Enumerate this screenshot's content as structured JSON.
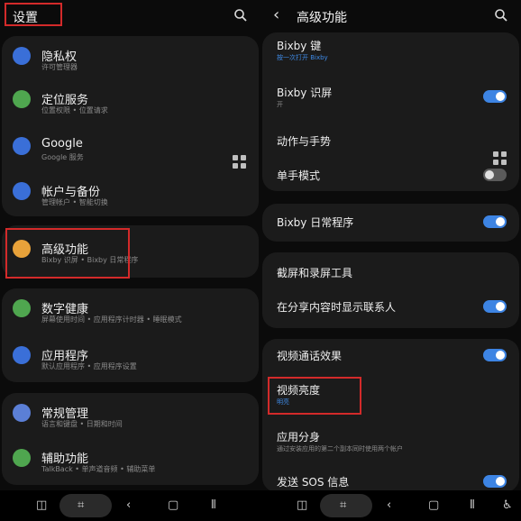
{
  "left": {
    "title": "设置",
    "items": [
      {
        "title": "隐私权",
        "subtitle": "许可管理器"
      },
      {
        "title": "定位服务",
        "subtitle": "位置权限 • 位置请求"
      },
      {
        "title": "Google",
        "subtitle": "Google 服务"
      },
      {
        "title": "帐户与备份",
        "subtitle": "管理帐户 • 智能切换"
      },
      {
        "title": "高级功能",
        "subtitle": "Bixby 识屏 • Bixby 日常程序"
      },
      {
        "title": "数字健康",
        "subtitle": "屏幕使用时间 • 应用程序计时器 • 睡眠模式"
      },
      {
        "title": "应用程序",
        "subtitle": "默认应用程序 • 应用程序设置"
      },
      {
        "title": "常规管理",
        "subtitle": "语言和键盘 • 日期和时间"
      },
      {
        "title": "辅助功能",
        "subtitle": "TalkBack • 单声道音频 • 辅助菜单"
      }
    ]
  },
  "right": {
    "title": "高级功能",
    "items": [
      {
        "title": "Bixby 键",
        "subtitle": "按一次打开 Bixby"
      },
      {
        "title": "Bixby 识屏",
        "subtitle": "开"
      },
      {
        "title": "动作与手势"
      },
      {
        "title": "单手模式"
      },
      {
        "title": "Bixby 日常程序"
      },
      {
        "title": "截屏和录屏工具"
      },
      {
        "title": "在分享内容时显示联系人"
      },
      {
        "title": "视频通话效果"
      },
      {
        "title": "视频亮度",
        "subtitle": "明亮"
      },
      {
        "title": "应用分身",
        "subtitle": "通过安装应用的第二个副本同时使用两个帐户"
      },
      {
        "title": "发送 SOS 信息"
      }
    ]
  },
  "colors": {
    "accent": "#3d84e3",
    "highlight_box": "#d32a2a",
    "card": "#1b1b1b"
  }
}
